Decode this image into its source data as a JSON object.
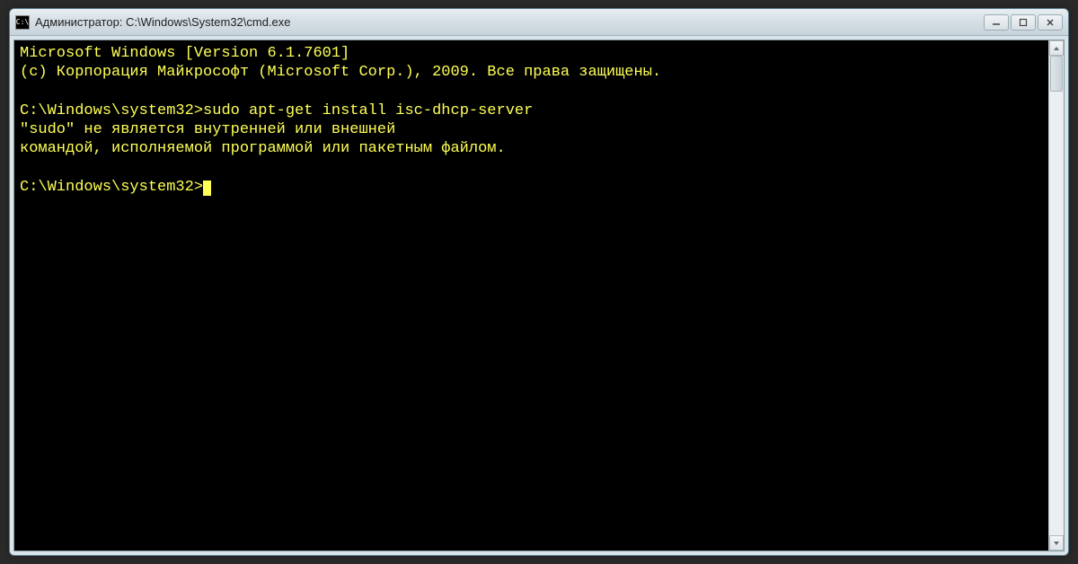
{
  "window": {
    "title": "Администратор: C:\\Windows\\System32\\cmd.exe",
    "icon_label": "C:\\"
  },
  "terminal": {
    "line1": "Microsoft Windows [Version 6.1.7601]",
    "line2": "(c) Корпорация Майкрософт (Microsoft Corp.), 2009. Все права защищены.",
    "blank1": "",
    "prompt1": "C:\\Windows\\system32>",
    "command1": "sudo apt-get install isc-dhcp-server",
    "error1": "\"sudo\" не является внутренней или внешней",
    "error2": "командой, исполняемой программой или пакетным файлом.",
    "blank2": "",
    "prompt2": "C:\\Windows\\system32>"
  },
  "colors": {
    "terminal_bg": "#000000",
    "terminal_fg": "#ffff55"
  }
}
